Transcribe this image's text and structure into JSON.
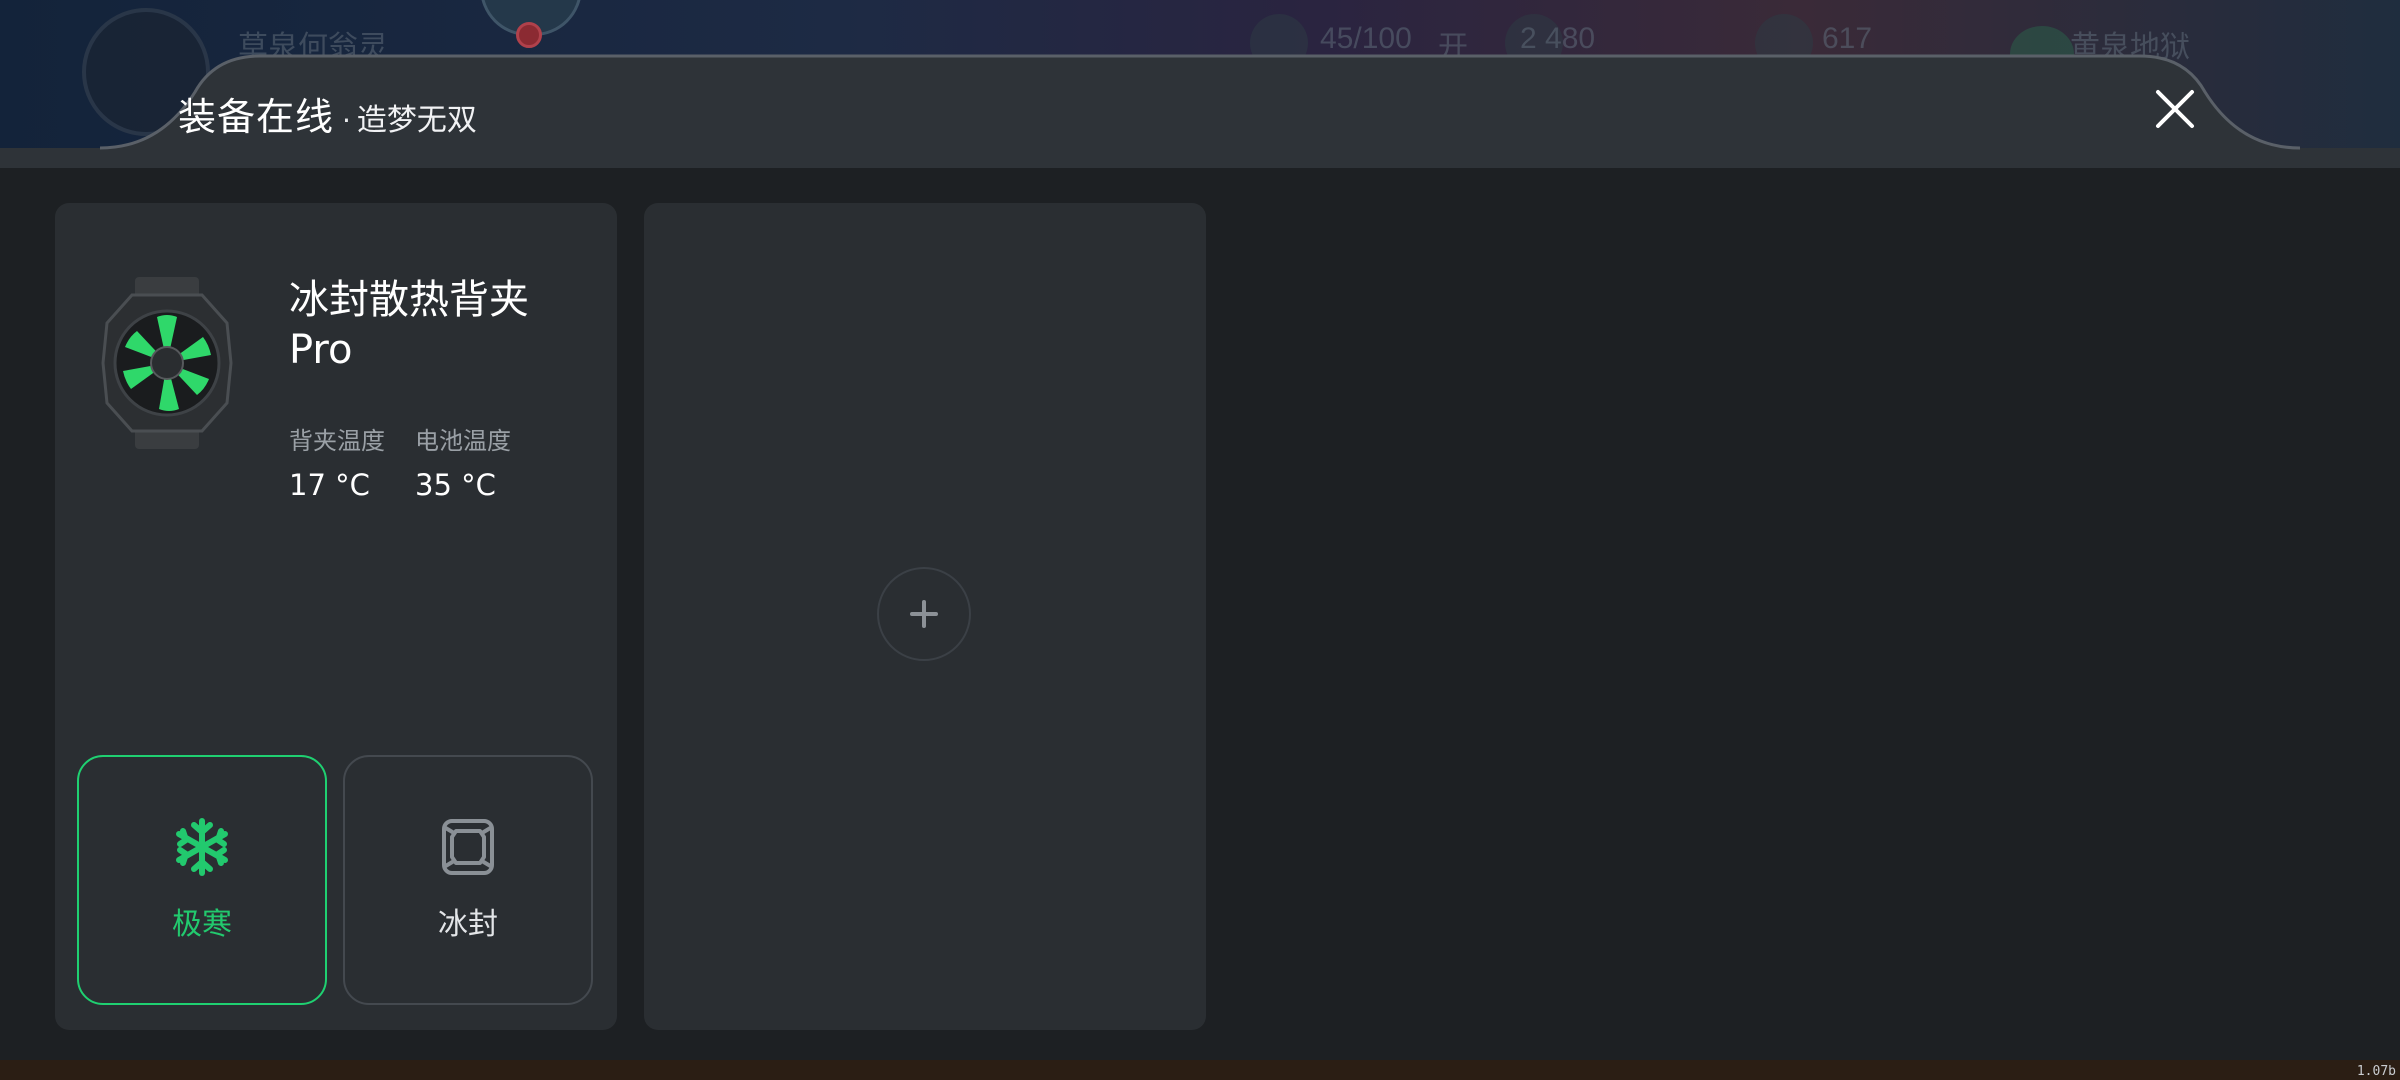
{
  "header": {
    "title": "装备在线",
    "separator": "·",
    "subtitle": "造梦无双",
    "close_icon": "close-icon"
  },
  "device": {
    "name": "冰封散热背夹 Pro",
    "image_icon": "cooling-fan-device-icon",
    "stats": [
      {
        "label": "背夹温度",
        "value": "17 °C"
      },
      {
        "label": "电池温度",
        "value": "35 °C"
      }
    ],
    "modes": [
      {
        "label": "极寒",
        "icon": "snowflake-icon",
        "selected": true,
        "color": "#22c96e"
      },
      {
        "label": "冰封",
        "icon": "ice-cube-icon",
        "selected": false,
        "color": "#8a9096"
      }
    ]
  },
  "add_slot": {
    "icon": "plus-icon"
  },
  "background_hud": {
    "text_1": "草泉何翁灵",
    "resource_1": "45/100",
    "resource_1_action": "开",
    "resource_2": "2 480",
    "resource_3": "617",
    "right_text": "黄泉地狱"
  },
  "version": "1.07b"
}
